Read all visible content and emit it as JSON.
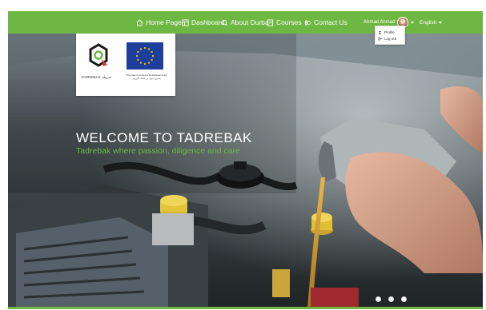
{
  "nav": {
    "home": "Home Page",
    "dashboard": "Dashboard",
    "about": "About Durba",
    "courses": "Courses",
    "contact": "Contact Us",
    "user_name": "Ahmad Ahmad",
    "language": "English"
  },
  "user_menu": {
    "profile": "Profile",
    "logout": "Log out"
  },
  "logos": {
    "tadrebak_word": "TADREBAK تدريبك",
    "eu_caption": "This project is funded by the European Union",
    "eu_caption_ar": "مشروع ممول من الاتحاد الأوروبي"
  },
  "hero": {
    "title": "WELCOME TO TADREBAK",
    "subtitle": "Tadrebak where passion, diligence and care"
  },
  "slider": {
    "count": 3
  },
  "colors": {
    "brand_green": "#6fb743",
    "eu_blue": "#1d3f9b",
    "eu_star": "#ffcc00"
  }
}
